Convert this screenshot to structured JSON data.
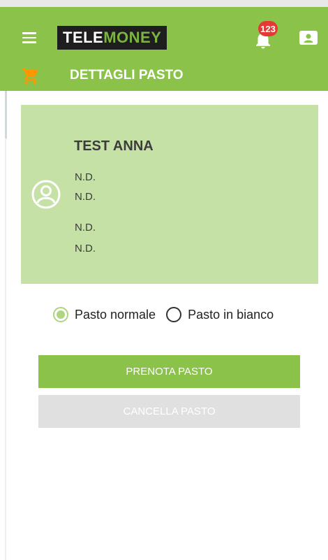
{
  "header": {
    "logo_tele": "TELE",
    "logo_money": "MONEY",
    "notification_count": "123",
    "section_title": "DETTAGLI PASTO"
  },
  "profile": {
    "name": "TEST ANNA",
    "lines": [
      "N.D.",
      "N.D.",
      "N.D.",
      "N.D."
    ]
  },
  "meal_options": {
    "normal_label": "Pasto normale",
    "plain_label": "Pasto in bianco",
    "selected": "normal"
  },
  "actions": {
    "book_label": "PRENOTA PASTO",
    "cancel_label": "CANCELLA PASTO"
  },
  "colors": {
    "app_bar": "#8bc34a",
    "card": "#c5e1a5",
    "cart": "#ff9800",
    "badge": "#e53935"
  },
  "icons": [
    "menu-icon",
    "bell-icon",
    "contact-card-icon",
    "cart-icon",
    "avatar-icon"
  ]
}
